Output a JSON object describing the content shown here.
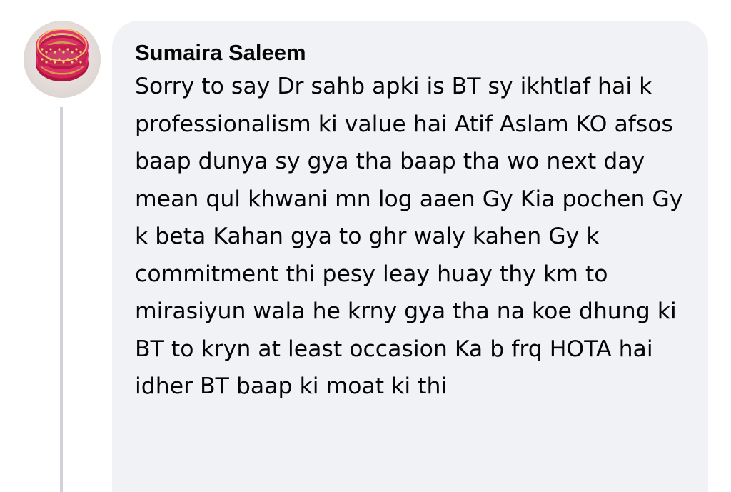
{
  "comment": {
    "author": "Sumaira Saleem",
    "text": "Sorry to say Dr sahb apki is BT sy ikhtlaf hai k professionalism ki value hai Atif Aslam KO afsos baap dunya sy gya tha baap tha wo next day mean qul khwani mn log aaen Gy Kia pochen Gy k beta Kahan gya to ghr waly kahen Gy k commitment thi pesy leay huay thy km to mirasiyun wala he krny gya tha na koe dhung ki BT to kryn at least occasion Ka b frq HOTA hai idher BT baap ki moat ki thi",
    "avatar_icon": "bangles-photo-avatar"
  },
  "colors": {
    "bubble_background": "#f0f2f5",
    "text": "#050505",
    "thread_line": "#cfd2d6"
  }
}
